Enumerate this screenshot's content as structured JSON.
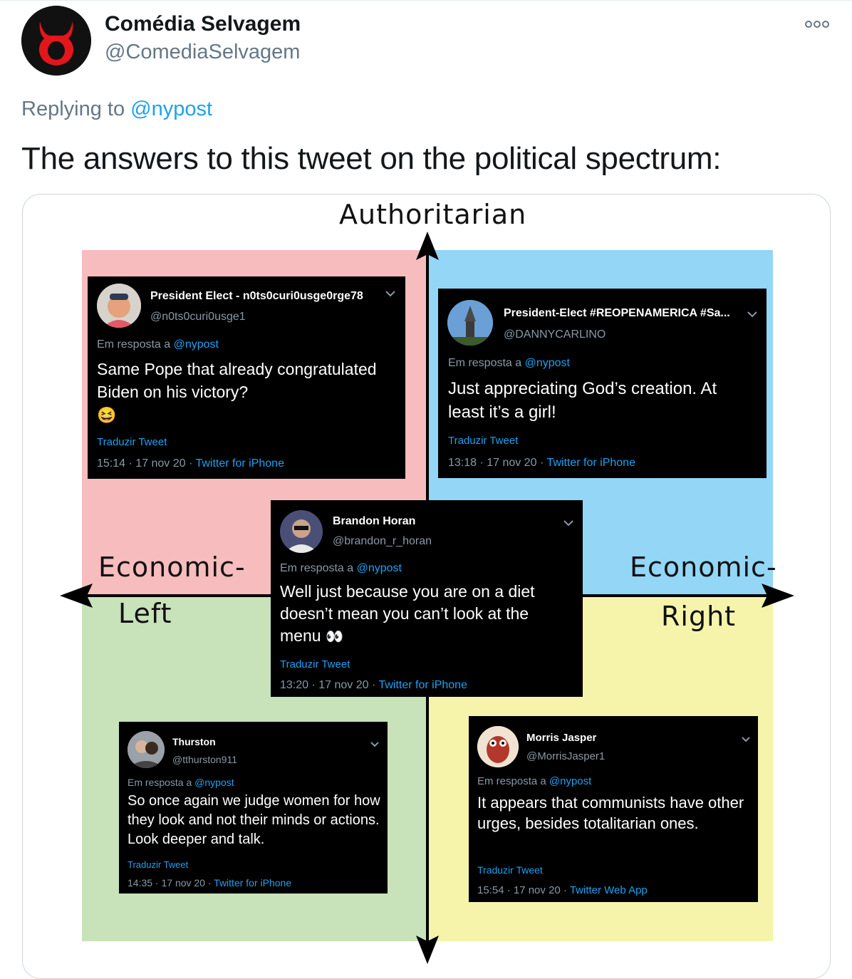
{
  "tweet": {
    "author_name": "Comédia Selvagem",
    "author_handle": "@ComediaSelvagem",
    "more_icon": "more-icon",
    "replying_prefix": "Replying to",
    "replying_handle": "@nypost",
    "text": "The answers to this tweet on the political spectrum:"
  },
  "compass": {
    "top_label": "Authoritarian",
    "left_label_1": "Economic-",
    "left_label_2": "Left",
    "right_label_1": "Economic-",
    "right_label_2": "Right",
    "colors": {
      "auth_left": "#f7bcbd",
      "auth_right": "#93d6f6",
      "lib_left": "#c8e2b9",
      "lib_right": "#f5f4aa"
    }
  },
  "cards": [
    {
      "name": "President Elect - n0ts0curi0usge0rge78",
      "handle": "@n0ts0curi0usge1",
      "reply_prefix": "Em resposta a",
      "reply_handle": "@nypost",
      "body": "Same Pope that already congratulated Biden on his victory?",
      "emoji": "😆",
      "translate": "Traduzir Tweet",
      "meta": "15:14 · 17 nov 20 · ",
      "source": "Twitter for iPhone"
    },
    {
      "name": "President-Elect #REOPENAMERICA #Sa...",
      "handle": "@DANNYCARLINO",
      "reply_prefix": "Em resposta a",
      "reply_handle": "@nypost",
      "body": "Just appreciating God’s creation. At least it’s a girl!",
      "translate": "Traduzir Tweet",
      "meta": "13:18 · 17 nov 20 · ",
      "source": "Twitter for iPhone"
    },
    {
      "name": "Brandon Horan",
      "handle": "@brandon_r_horan",
      "reply_prefix": "Em resposta a",
      "reply_handle": "@nypost",
      "body": "Well just because you are on a diet doesn’t mean you can’t look at the menu",
      "emoji": "👀",
      "translate": "Traduzir Tweet",
      "meta": "13:20 · 17 nov 20 · ",
      "source": "Twitter for iPhone"
    },
    {
      "name": "Thurston",
      "handle": "@tthurston911",
      "reply_prefix": "Em resposta a",
      "reply_handle": "@nypost",
      "body": "So once again we judge women for how they look and not their minds or actions. Look deeper and talk.",
      "translate": "Traduzir Tweet",
      "meta": "14:35 · 17 nov 20 · ",
      "source": "Twitter for iPhone"
    },
    {
      "name": "Morris Jasper",
      "handle": "@MorrisJasper1",
      "reply_prefix": "Em resposta a",
      "reply_handle": "@nypost",
      "body": "It appears that communists have other urges, besides totalitarian ones.",
      "translate": "Traduzir Tweet",
      "meta": "15:54 · 17 nov 20 · ",
      "source": "Twitter Web App"
    }
  ]
}
